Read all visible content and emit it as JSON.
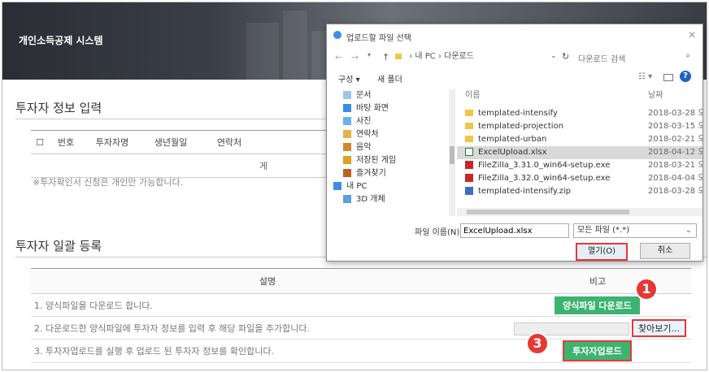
{
  "app": {
    "title": "개인소득공제 시스템"
  },
  "investor_info": {
    "title": "투자자 정보 입력",
    "columns": [
      "번호",
      "투자자명",
      "생년월일",
      "연락처"
    ],
    "empty_row_text": "게",
    "note": "※투자확인서 신청은 개인만 가능합니다."
  },
  "bulk": {
    "title": "투자자 일괄 등록",
    "col_desc": "설명",
    "col_note": "비고",
    "rows": [
      {
        "desc": "1. 양식파일을 다운로드 합니다."
      },
      {
        "desc": "2. 다운로드한 양식파일에 투자자 정보를 입력 후 해당 파일을 추가합니다."
      },
      {
        "desc": "3. 투자자업로드를 실행 후 업로드 된 투자자 정보를 확인합니다."
      }
    ],
    "btn_download": "양식파일 다운로드",
    "btn_browse": "찾아보기...",
    "btn_upload": "투자자업로드"
  },
  "badges": [
    "1",
    "2",
    "3"
  ],
  "dialog": {
    "title": "업로드할 파일 선택",
    "path": [
      "내 PC",
      "다운로드"
    ],
    "search_placeholder": "다운로드 검색",
    "organize": "구성 ▾",
    "new_folder": "새 폴더",
    "nav_items": [
      "문서",
      "바탕 화면",
      "사진",
      "연락처",
      "음악",
      "저장된 게임",
      "즐겨찾기",
      "내 PC",
      "3D 개체"
    ],
    "col_name": "이름",
    "col_date": "날짜",
    "files": [
      {
        "name": "templated-intensify",
        "date": "2018-03-28 오",
        "type": "folder"
      },
      {
        "name": "templated-projection",
        "date": "2018-03-15 오",
        "type": "folder"
      },
      {
        "name": "templated-urban",
        "date": "2018-02-21 오",
        "type": "folder"
      },
      {
        "name": "ExcelUpload.xlsx",
        "date": "2018-04-12 오",
        "type": "excel",
        "selected": true
      },
      {
        "name": "FileZilla_3.31.0_win64-setup.exe",
        "date": "2018-03-21 오",
        "type": "exe"
      },
      {
        "name": "FileZilla_3.32.0_win64-setup.exe",
        "date": "2018-04-04 오",
        "type": "exe"
      },
      {
        "name": "templated-intensify.zip",
        "date": "2018-03-28 오",
        "type": "zip"
      }
    ],
    "filename_label": "파일 이름(N):",
    "filename_value": "ExcelUpload.xlsx",
    "filter_value": "모든 파일 (*.*)",
    "open_label": "열기(O)",
    "cancel_label": "취소"
  },
  "colors": {
    "green": "#3cb371",
    "red": "#e53935",
    "header_dark": "#2a2d34"
  }
}
